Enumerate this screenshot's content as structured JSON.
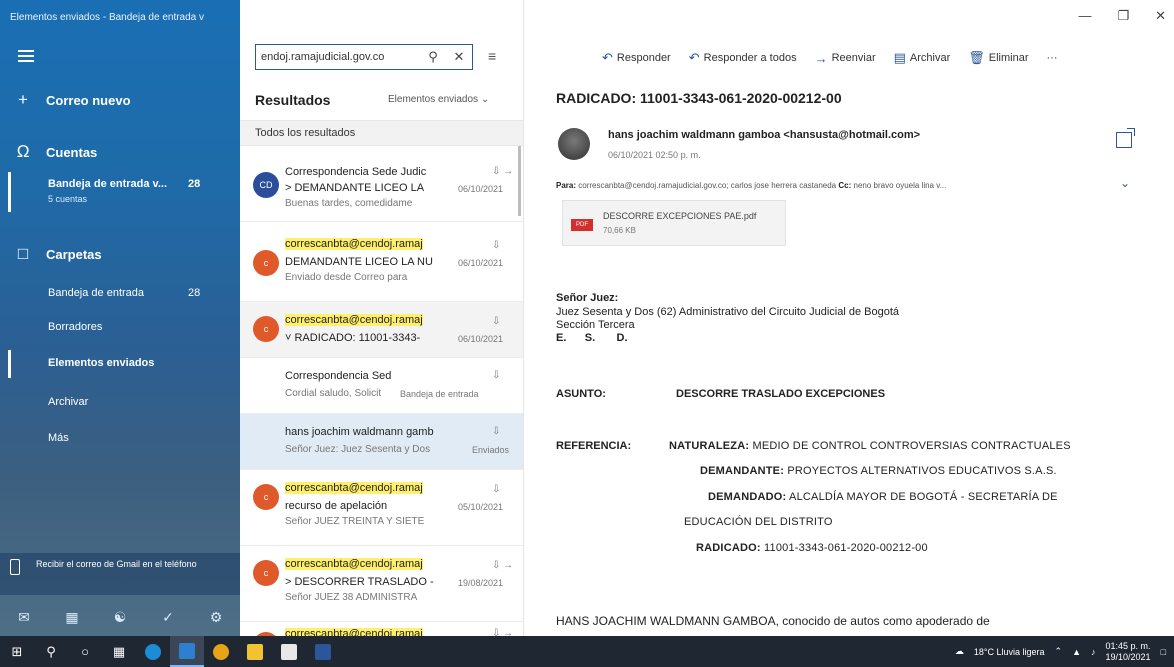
{
  "window": {
    "title": "Elementos enviados - Bandeja de entrada v"
  },
  "nav": {
    "new_mail": "Correo nuevo",
    "accounts": "Cuentas",
    "account_name": "Bandeja de entrada v...",
    "account_count": "28",
    "account_sub": "5 cuentas",
    "folders": "Carpetas",
    "folder_items": [
      {
        "label": "Bandeja de entrada",
        "count": "28"
      },
      {
        "label": "Borradores",
        "count": ""
      },
      {
        "label": "Elementos enviados",
        "count": ""
      },
      {
        "label": "Archivar",
        "count": ""
      },
      {
        "label": "Más",
        "count": ""
      }
    ],
    "gmail_tip": "Recibir el correo de Gmail en el teléfono",
    "bottom_icons": [
      "mail-icon",
      "calendar-icon",
      "people-icon",
      "todo-icon",
      "settings-icon"
    ]
  },
  "list": {
    "search_value": "endoj.ramajudicial.gov.co",
    "results_title": "Resultados",
    "results_filter": "Elementos enviados",
    "all_results": "Todos los resultados",
    "messages": [
      {
        "avatar": "CD",
        "avatar_color": "#2b4e9c",
        "from": "Correspondencia Sede Judic",
        "subject": "> DEMANDANTE LICEO LA",
        "date": "06/10/2021",
        "preview": "Buenas tardes, comedidame",
        "icons": "⇩ →"
      },
      {
        "avatar": "c",
        "avatar_color": "#e0592a",
        "from": "correscanbta@cendoj.ramaj",
        "subject": "DEMANDANTE LICEO LA NU",
        "date": "06/10/2021",
        "preview": "Enviado desde Correo para",
        "icons": "⇩"
      },
      {
        "avatar": "c",
        "avatar_color": "#e0592a",
        "from": "correscanbta@cendoj.ramaj",
        "subject": "˅ RADICADO: 11001-3343-",
        "date": "06/10/2021",
        "preview": "",
        "icons": "⇩"
      },
      {
        "avatar": "",
        "avatar_color": "",
        "from": "Correspondencia Sed",
        "subject": "",
        "date": "",
        "preview": "Cordial saludo, Solicit",
        "tag": "Bandeja de entrada",
        "icons": "⇩"
      },
      {
        "avatar": "",
        "avatar_color": "",
        "from": "hans joachim waldmann gamb",
        "subject": "",
        "date": "",
        "preview": "Señor Juez: Juez Sesenta y Dos",
        "tag": "Enviados",
        "icons": "⇩"
      },
      {
        "avatar": "c",
        "avatar_color": "#e0592a",
        "from": "correscanbta@cendoj.ramaj",
        "subject": "recurso de apelación",
        "date": "05/10/2021",
        "preview": "Señor JUEZ TREINTA Y SIETE",
        "icons": "⇩"
      },
      {
        "avatar": "c",
        "avatar_color": "#e0592a",
        "from": "correscanbta@cendoj.ramaj",
        "subject": "> DESCORRER TRASLADO -",
        "date": "19/08/2021",
        "preview": "Señor JUEZ 38 ADMINISTRA",
        "icons": "⇩ →"
      },
      {
        "avatar": "c",
        "avatar_color": "#e0592a",
        "from": "correscanbta@cendoj.ramaj",
        "subject": "",
        "date": "",
        "preview": "",
        "icons": "⇩ →"
      }
    ]
  },
  "toolbar": {
    "reply": "Responder",
    "reply_all": "Responder a todos",
    "forward": "Reenviar",
    "archive": "Archivar",
    "delete": "Eliminar",
    "more": "···"
  },
  "message": {
    "subject": "RADICADO: 11001-3343-061-2020-00212-00",
    "sender": "hans joachim waldmann gamboa <hansusta@hotmail.com>",
    "sent": "06/10/2021 02:50 p. m.",
    "to_label": "Para:",
    "to": "correscanbta@cendoj.ramajudicial.gov.co; carlos jose herrera castaneda",
    "cc_label": "Cc:",
    "cc": "neno bravo oyuela lina v...",
    "attachment_name": "DESCORRE EXCEPCIONES PAE.pdf",
    "attachment_size": "70,66 KB",
    "attachment_type": "PDF",
    "body": {
      "greeting": "Señor Juez:",
      "court": "Juez Sesenta y Dos (62) Administrativo del Circuito Judicial de Bogotá",
      "section": "Sección Tercera",
      "esd": "E.      S.       D.",
      "asunto_label": "ASUNTO:",
      "asunto": "DESCORRE TRASLADO EXCEPCIONES",
      "ref_label": "REFERENCIA:",
      "naturaleza_label": "NATURALEZA:",
      "naturaleza": "MEDIO DE CONTROL CONTROVERSIAS CONTRACTUALES",
      "demandante_label": "DEMANDANTE:",
      "demandante": "PROYECTOS ALTERNATIVOS EDUCATIVOS S.A.S.",
      "demandado_label": "DEMANDADO:",
      "demandado": "ALCALDÍA MAYOR DE BOGOTÁ - SECRETARÍA DE",
      "demandado_cont": "EDUCACIÓN DEL DISTRITO",
      "radicado_label": "RADICADO:",
      "radicado": "11001-3343-061-2020-00212-00",
      "closing": "HANS JOACHIM WALDMANN GAMBOA, conocido de autos como apoderado de"
    }
  },
  "taskbar": {
    "weather": "18°C  Lluvia ligera",
    "time": "01:45 p. m.",
    "date": "19/10/2021"
  }
}
